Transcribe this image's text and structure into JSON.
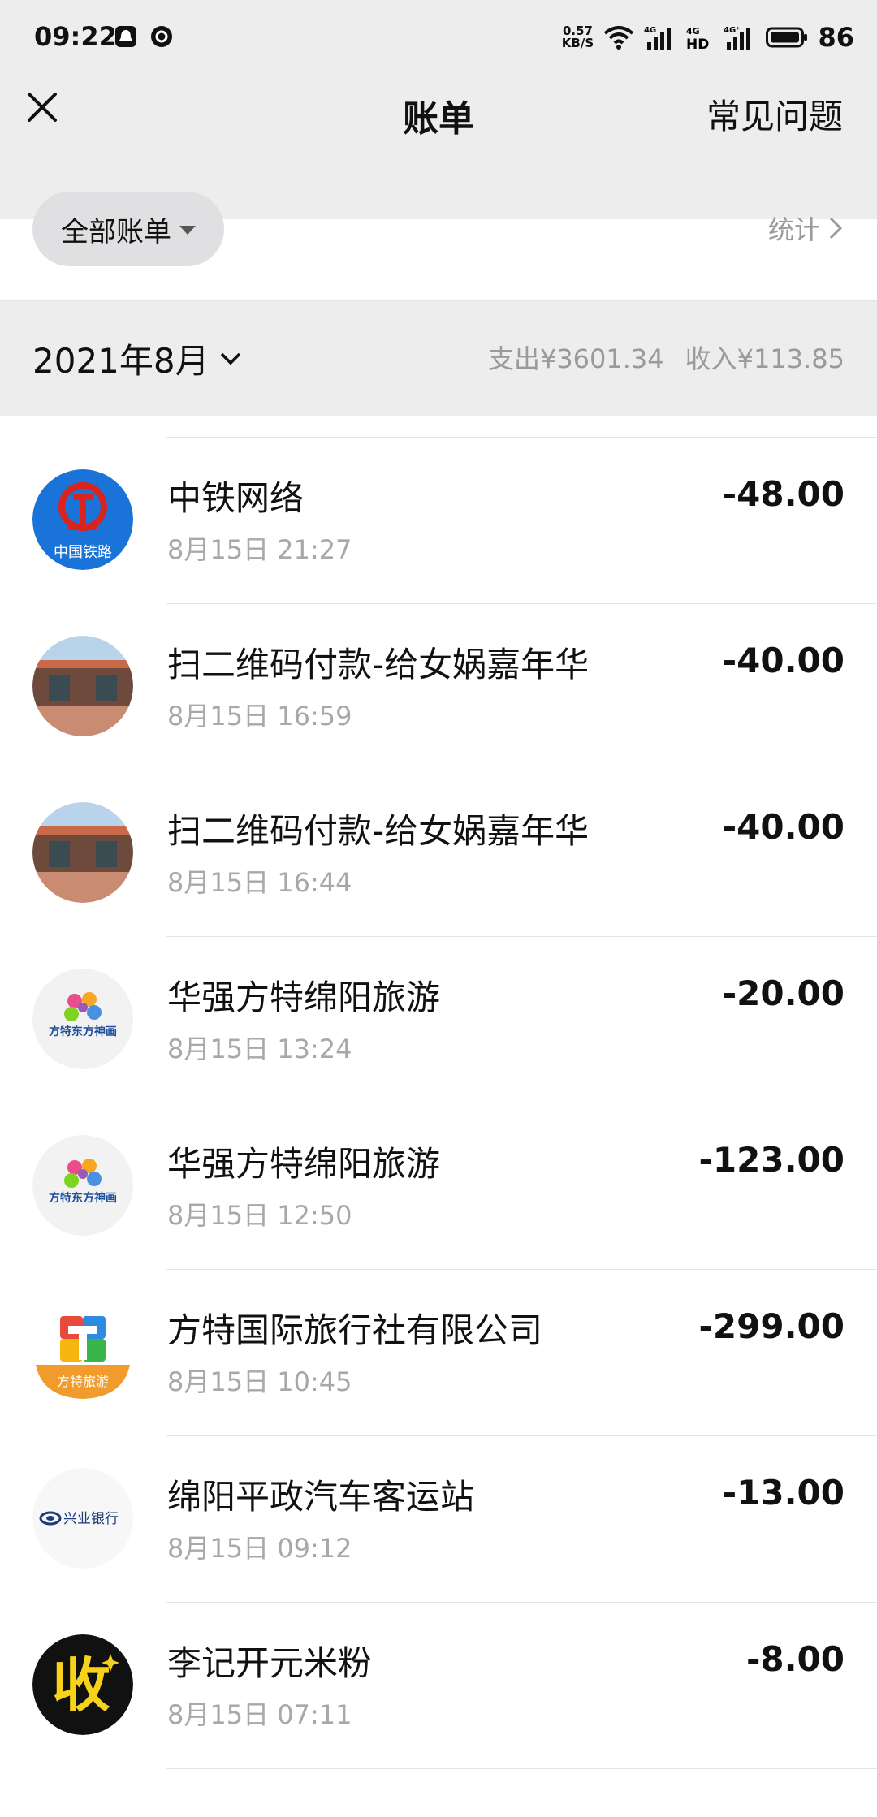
{
  "status_bar": {
    "time": "09:22",
    "net_speed_top": "0.57",
    "net_speed_bottom": "KB/S",
    "battery": "86",
    "icons": [
      "bell-icon",
      "circle-app-icon",
      "wifi-icon",
      "signal-4g-icon",
      "hd-icon",
      "signal-4g-icon",
      "battery-icon"
    ]
  },
  "header": {
    "title": "账单",
    "faq_label": "常见问题",
    "close_icon": "close-icon"
  },
  "filter": {
    "label": "全部账单",
    "stats_label": "统计"
  },
  "month_bar": {
    "month": "2021年8月",
    "expense": "支出¥3601.34",
    "income": "收入¥113.85"
  },
  "transactions": [
    {
      "merchant": "中铁网络",
      "datetime": "8月15日 21:27",
      "amount": "-48.00",
      "avatar": "china-railway-logo",
      "avatar_text": "中国铁路"
    },
    {
      "merchant": "扫二维码付款-给女娲嘉年华",
      "datetime": "8月15日 16:59",
      "amount": "-40.00",
      "avatar": "temple-photo"
    },
    {
      "merchant": "扫二维码付款-给女娲嘉年华",
      "datetime": "8月15日 16:44",
      "amount": "-40.00",
      "avatar": "temple-photo"
    },
    {
      "merchant": "华强方特绵阳旅游",
      "datetime": "8月15日 13:24",
      "amount": "-20.00",
      "avatar": "oriental-heritage-logo",
      "avatar_text": "方特东方神画"
    },
    {
      "merchant": "华强方特绵阳旅游",
      "datetime": "8月15日 12:50",
      "amount": "-123.00",
      "avatar": "oriental-heritage-logo",
      "avatar_text": "方特东方神画"
    },
    {
      "merchant": "方特国际旅行社有限公司",
      "datetime": "8月15日 10:45",
      "amount": "-299.00",
      "avatar": "fangte-travel-logo",
      "avatar_text": "方特旅游"
    },
    {
      "merchant": "绵阳平政汽车客运站",
      "datetime": "8月15日 09:12",
      "amount": "-13.00",
      "avatar": "industrial-bank-logo",
      "avatar_text": "兴业银行"
    },
    {
      "merchant": "李记开元米粉",
      "datetime": "8月15日 07:11",
      "amount": "-8.00",
      "avatar": "shou-collect-logo",
      "avatar_text": "收"
    }
  ],
  "colors": {
    "header_bg": "#ededed",
    "railway_blue": "#1a73d9",
    "railway_red": "#d8231f",
    "fangte_orange": "#f29b2d",
    "shou_yellow": "#f7d21a"
  }
}
